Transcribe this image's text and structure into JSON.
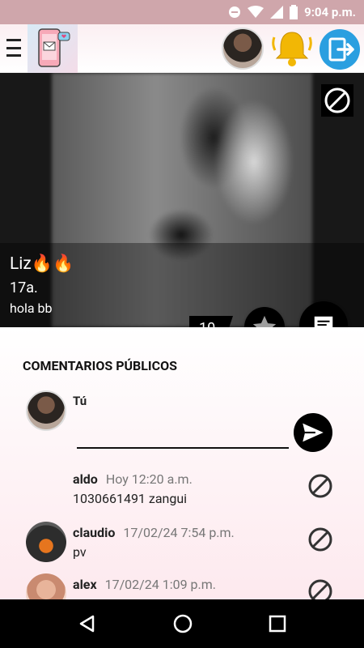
{
  "status_bar": {
    "time": "9:04 p.m."
  },
  "profile": {
    "name": "Liz🔥🔥",
    "age": "17a.",
    "status": "hola bb",
    "likes": "10"
  },
  "comments_section": {
    "title": "COMENTARIOS PÚBLICOS",
    "me_label": "Tú",
    "input_value": "",
    "input_placeholder": ""
  },
  "comments": [
    {
      "author": "aldo",
      "time": "Hoy 12:20 a.m.",
      "text": "1030661491 zangui"
    },
    {
      "author": "claudio",
      "time": "17/02/24 7:54 p.m.",
      "text": "pv"
    },
    {
      "author": "alex",
      "time": "17/02/24 1:09 p.m.",
      "text": ""
    }
  ],
  "icons": {
    "menu": "hamburger-icon",
    "notifications": "bell-icon",
    "logout": "logout-icon",
    "block": "block-icon",
    "star": "star-icon",
    "chat": "chat-icon",
    "send": "send-icon",
    "back": "back-icon",
    "home": "home-icon",
    "recents": "recents-icon"
  },
  "colors": {
    "status_bar": "#cfa6ab",
    "accent_bell": "#f2b705",
    "logout_blue": "#2a9fe0"
  }
}
